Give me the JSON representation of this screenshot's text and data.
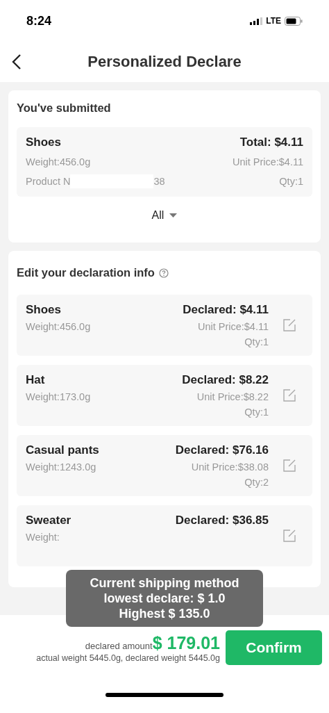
{
  "status_bar": {
    "time": "8:24",
    "network": "LTE"
  },
  "header": {
    "title": "Personalized Declare"
  },
  "submitted": {
    "title": "You've submitted",
    "item": {
      "name": "Shoes",
      "total": "Total: $4.11",
      "weight": "Weight:456.0g",
      "unit_price": "Unit Price:$4.11",
      "product_number_start": "Product N",
      "product_number_end": "38",
      "qty": "Qty:1"
    },
    "toggle": "All"
  },
  "declaration": {
    "title": "Edit your declaration info",
    "items": [
      {
        "name": "Shoes",
        "declared": "Declared: $4.11",
        "weight": "Weight:456.0g",
        "unit_price": "Unit Price:$4.11",
        "qty": "Qty:1"
      },
      {
        "name": "Hat",
        "declared": "Declared: $8.22",
        "weight": "Weight:173.0g",
        "unit_price": "Unit Price:$8.22",
        "qty": "Qty:1"
      },
      {
        "name": "Casual pants",
        "declared": "Declared: $76.16",
        "weight": "Weight:1243.0g",
        "unit_price": "Unit Price:$38.08",
        "qty": "Qty:2"
      },
      {
        "name": "Sweater",
        "declared": "Declared: $36.85",
        "weight": "Weight:"
      }
    ]
  },
  "toast": {
    "lines": [
      "Current shipping method",
      "lowest declare: $ 1.0",
      "Highest $ 135.0"
    ]
  },
  "footer": {
    "amount_label": "declared amount",
    "amount": "$ 179.01",
    "weights": "actual weight 5445.0g, declared weight 5445.0g",
    "confirm": "Confirm"
  }
}
